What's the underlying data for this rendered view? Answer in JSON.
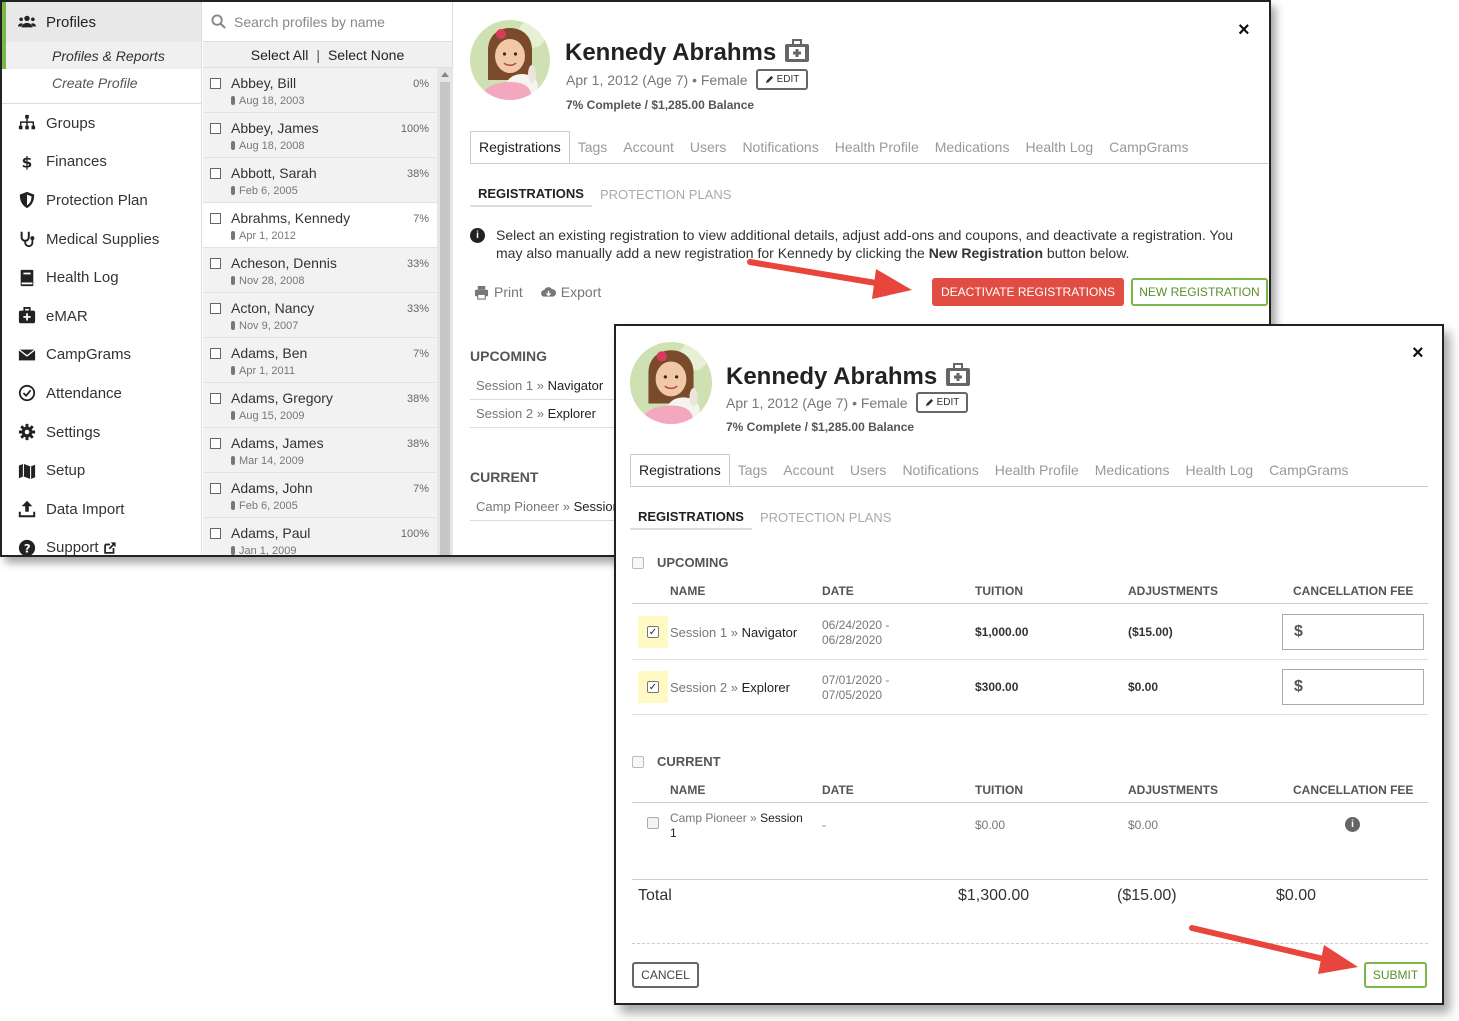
{
  "sidebar": {
    "profiles_label": "Profiles",
    "profiles_reports": "Profiles & Reports",
    "create_profile": "Create Profile",
    "items": [
      {
        "label": "Groups",
        "icon": "sitemap-icon"
      },
      {
        "label": "Finances",
        "icon": "dollar-icon"
      },
      {
        "label": "Protection Plan",
        "icon": "shield-icon"
      },
      {
        "label": "Medical Supplies",
        "icon": "stethoscope-icon"
      },
      {
        "label": "Health Log",
        "icon": "book-icon"
      },
      {
        "label": "eMAR",
        "icon": "medkit-icon"
      },
      {
        "label": "CampGrams",
        "icon": "envelope-icon"
      },
      {
        "label": "Attendance",
        "icon": "check-circle-icon"
      },
      {
        "label": "Settings",
        "icon": "gear-icon"
      },
      {
        "label": "Setup",
        "icon": "map-icon"
      },
      {
        "label": "Data Import",
        "icon": "upload-icon"
      },
      {
        "label": "Support",
        "icon": "question-circle-icon"
      }
    ]
  },
  "profile_list": {
    "search_placeholder": "Search profiles by name",
    "select_all": "Select All",
    "select_none": "Select None",
    "rows": [
      {
        "name": "Abbey, Bill",
        "date": "Aug 18, 2003",
        "pct": "0%"
      },
      {
        "name": "Abbey, James",
        "date": "Aug 18, 2008",
        "pct": "100%"
      },
      {
        "name": "Abbott, Sarah",
        "date": "Feb 6, 2005",
        "pct": "38%"
      },
      {
        "name": "Abrahms, Kennedy",
        "date": "Apr 1, 2012",
        "pct": "7%"
      },
      {
        "name": "Acheson, Dennis",
        "date": "Nov 28, 2008",
        "pct": "33%"
      },
      {
        "name": "Acton, Nancy",
        "date": "Nov 9, 2007",
        "pct": "33%"
      },
      {
        "name": "Adams, Ben",
        "date": "Apr 1, 2011",
        "pct": "7%"
      },
      {
        "name": "Adams, Gregory",
        "date": "Aug 15, 2009",
        "pct": "38%"
      },
      {
        "name": "Adams, James",
        "date": "Mar 14, 2009",
        "pct": "38%"
      },
      {
        "name": "Adams, John",
        "date": "Feb 6, 2005",
        "pct": "7%"
      },
      {
        "name": "Adams, Paul",
        "date": "Jan 1, 2009",
        "pct": "100%"
      }
    ]
  },
  "profile": {
    "name": "Kennedy Abrahms",
    "meta": "Apr 1, 2012 (Age 7) • Female",
    "edit": "EDIT",
    "balance": "7% Complete / $1,285.00 Balance",
    "close": "×"
  },
  "tabs": [
    "Registrations",
    "Tags",
    "Account",
    "Users",
    "Notifications",
    "Health Profile",
    "Medications",
    "Health Log",
    "CampGrams"
  ],
  "subtabs": [
    "REGISTRATIONS",
    "PROTECTION PLANS"
  ],
  "info_text_1": "Select an existing registration to view additional details, adjust add-ons and coupons, and deactivate a registration. You may also manually add a new registration for Kennedy by clicking the ",
  "info_text_bold": "New Registration",
  "info_text_2": " button below.",
  "print": "Print",
  "export": "Export",
  "deactivate_btn": "DEACTIVATE REGISTRATIONS",
  "new_reg_btn": "NEW REGISTRATION",
  "upcoming_label": "UPCOMING",
  "current_label": "CURRENT",
  "bg_upcoming": [
    {
      "camp": "Session 1",
      "session": "Navigator"
    },
    {
      "camp": "Session 2",
      "session": "Explorer"
    }
  ],
  "bg_current": [
    {
      "camp": "Camp Pioneer",
      "session": "Session"
    }
  ],
  "modal": {
    "columns": [
      "NAME",
      "DATE",
      "TUITION",
      "ADJUSTMENTS",
      "CANCELLATION FEE"
    ],
    "upcoming": [
      {
        "camp": "Session 1",
        "session": "Navigator",
        "date1": "06/24/2020 -",
        "date2": "06/28/2020",
        "tuition": "$1,000.00",
        "adjustments": "($15.00)",
        "fee": "$"
      },
      {
        "camp": "Session 2",
        "session": "Explorer",
        "date1": "07/01/2020 -",
        "date2": "07/05/2020",
        "tuition": "$300.00",
        "adjustments": "$0.00",
        "fee": "$"
      }
    ],
    "current": [
      {
        "camp": "Camp Pioneer",
        "session": "Session",
        "session2": "1",
        "date": "-",
        "tuition": "$0.00",
        "adjustments": "$0.00"
      }
    ],
    "total_label": "Total",
    "total_tuition": "$1,300.00",
    "total_adjustments": "($15.00)",
    "total_fee": "$0.00",
    "cancel": "CANCEL",
    "submit": "SUBMIT"
  },
  "colors": {
    "accent_green": "#7ab648",
    "danger_red": "#e14d43",
    "arrow_red": "#e8453c",
    "highlight_yellow": "#fff9c4"
  }
}
